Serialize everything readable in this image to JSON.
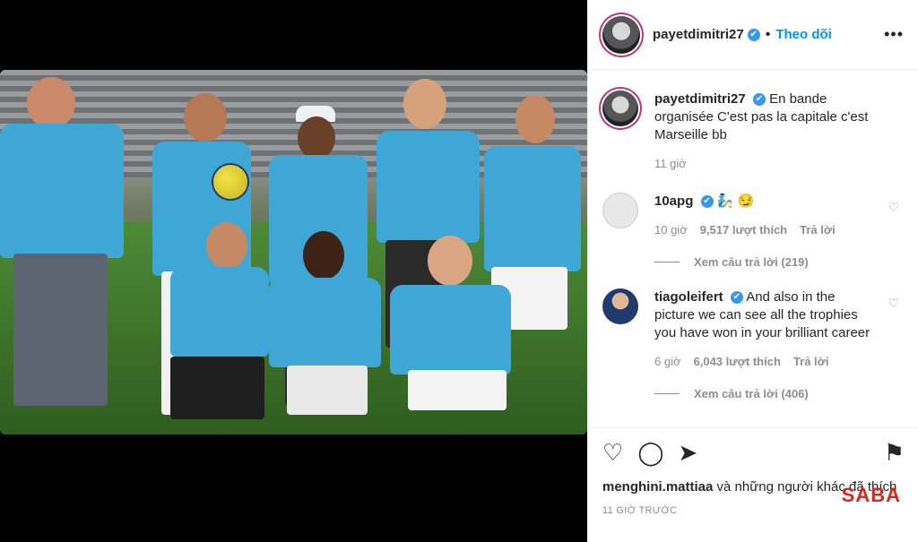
{
  "post": {
    "username": "payetdimitri27",
    "verified_mark": "✔",
    "dot": "•",
    "follow_label": "Theo dõi",
    "more_label": "•••",
    "caption": "En bande organisée C'est pas la capitale c'est Marseille bb",
    "caption_time": "11 giờ"
  },
  "comments": [
    {
      "username": "10apg",
      "text": "🧞 😏",
      "time": "10 giờ",
      "likes": "9,517 lượt thích",
      "reply_label": "Trả lời",
      "view_replies": "Xem câu trả lời (219)",
      "avatar_color": "#e8e8e8"
    },
    {
      "username": "tiagoleifert",
      "text": "And also in the picture we can see all the trophies you have won in your brilliant career",
      "time": "6 giờ",
      "likes": "6,043 lượt thích",
      "reply_label": "Trả lời",
      "view_replies": "Xem câu trả lời (406)",
      "avatar_color": "#1f3a6b"
    }
  ],
  "footer": {
    "liked_by_user": "menghini.mattiaa",
    "liked_by_rest": " và những người khác đã thích",
    "timestamp": "11 GIỜ TRƯỚC",
    "watermark": "SABA"
  },
  "icons": {
    "heart": "♡",
    "comment": "◯",
    "share": "➤",
    "bookmark": "⚑"
  },
  "colors": {
    "accent": "#0095f6",
    "jersey": "#3fa7d6",
    "watermark": "#e2231a"
  }
}
